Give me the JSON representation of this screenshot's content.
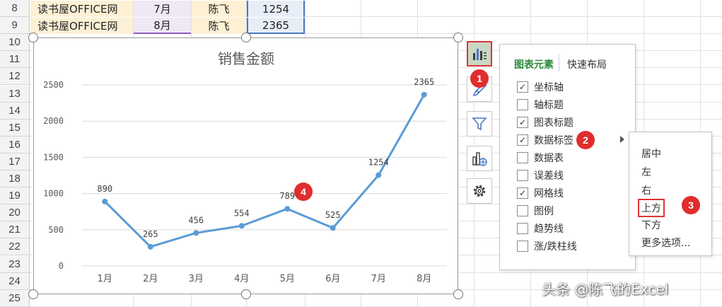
{
  "sheet": {
    "row_numbers": [
      "8",
      "9",
      "10",
      "11",
      "12",
      "13",
      "14",
      "15",
      "16",
      "17",
      "18",
      "19",
      "20",
      "21",
      "22",
      "23",
      "24",
      "25"
    ],
    "rows": [
      {
        "store": "读书屋OFFICE网",
        "month": "7月",
        "name": "陈飞",
        "amount": "1254"
      },
      {
        "store": "读书屋OFFICE网",
        "month": "8月",
        "name": "陈飞",
        "amount": "2365"
      }
    ]
  },
  "chart_data": {
    "type": "line",
    "title": "销售金额",
    "categories": [
      "1月",
      "2月",
      "3月",
      "4月",
      "5月",
      "6月",
      "7月",
      "8月"
    ],
    "values": [
      890,
      265,
      456,
      554,
      789,
      525,
      1254,
      2365
    ],
    "ylim": [
      0,
      2500
    ],
    "yticks": [
      "0",
      "500",
      "1000",
      "1500",
      "2000",
      "2500"
    ],
    "grid": true,
    "legend": "none",
    "line_color": "#5b9bd5",
    "data_labels": "above"
  },
  "tools": {
    "chart_elements": "chart-elements-icon",
    "chart_styles": "brush-icon",
    "chart_filters": "filter-icon",
    "chart_type": "chart-type-icon",
    "settings": "gear-icon"
  },
  "panel": {
    "tab_elements": "图表元素",
    "tab_layout": "快速布局",
    "options": [
      {
        "label": "坐标轴",
        "checked": true
      },
      {
        "label": "轴标题",
        "checked": false
      },
      {
        "label": "图表标题",
        "checked": true
      },
      {
        "label": "数据标签",
        "checked": true
      },
      {
        "label": "数据表",
        "checked": false
      },
      {
        "label": "误差线",
        "checked": false
      },
      {
        "label": "网格线",
        "checked": true
      },
      {
        "label": "图例",
        "checked": false
      },
      {
        "label": "趋势线",
        "checked": false
      },
      {
        "label": "涨/跌柱线",
        "checked": false
      }
    ]
  },
  "submenu": {
    "items": [
      "居中",
      "左",
      "右",
      "上方",
      "下方",
      "更多选项..."
    ]
  },
  "badges": [
    "1",
    "2",
    "3",
    "4"
  ],
  "colors": {
    "accent_red": "#e02d2d",
    "tab_green": "#2f8a3d"
  },
  "watermark": "头条 @陈飞的Excel"
}
